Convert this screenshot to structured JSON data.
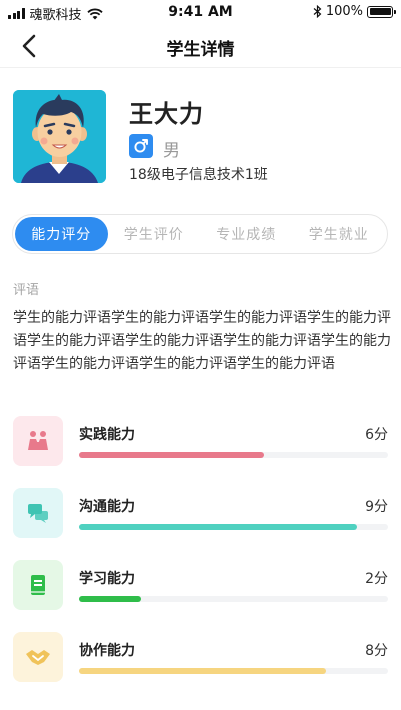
{
  "status_bar": {
    "carrier": "魂歌科技",
    "time": "9:41 AM",
    "battery": "100%"
  },
  "nav": {
    "title": "学生详情",
    "back_icon": "chevron-left-icon"
  },
  "profile": {
    "name": "王大力",
    "gender": "男",
    "gender_icon": "male-icon",
    "class": "18级电子信息技术1班"
  },
  "tabs": [
    {
      "label": "能力评分",
      "active": true
    },
    {
      "label": "学生评价",
      "active": false
    },
    {
      "label": "专业成绩",
      "active": false
    },
    {
      "label": "学生就业",
      "active": false
    }
  ],
  "comment": {
    "label": "评语",
    "text": "学生的能力评语学生的能力评语学生的能力评语学生的能力评语学生的能力评语学生的能力评语学生的能力评语学生的能力评语学生的能力评语学生的能力评语学生的能力评语"
  },
  "skills": [
    {
      "name": "实践能力",
      "score": "6分",
      "progress": 0.6,
      "color": "#e8798b",
      "icon_bg": "#fde8ec",
      "icon": "people-icon"
    },
    {
      "name": "沟通能力",
      "score": "9分",
      "progress": 0.9,
      "color": "#4fd1c0",
      "icon_bg": "#e1f7f7",
      "icon": "chat-icon"
    },
    {
      "name": "学习能力",
      "score": "2分",
      "progress": 0.2,
      "color": "#2fbd4a",
      "icon_bg": "#e5f8e6",
      "icon": "book-icon"
    },
    {
      "name": "协作能力",
      "score": "8分",
      "progress": 0.8,
      "color": "#f6d580",
      "icon_bg": "#fdf3db",
      "icon": "handshake-icon"
    }
  ],
  "colors": {
    "accent": "#2e8cf0"
  }
}
